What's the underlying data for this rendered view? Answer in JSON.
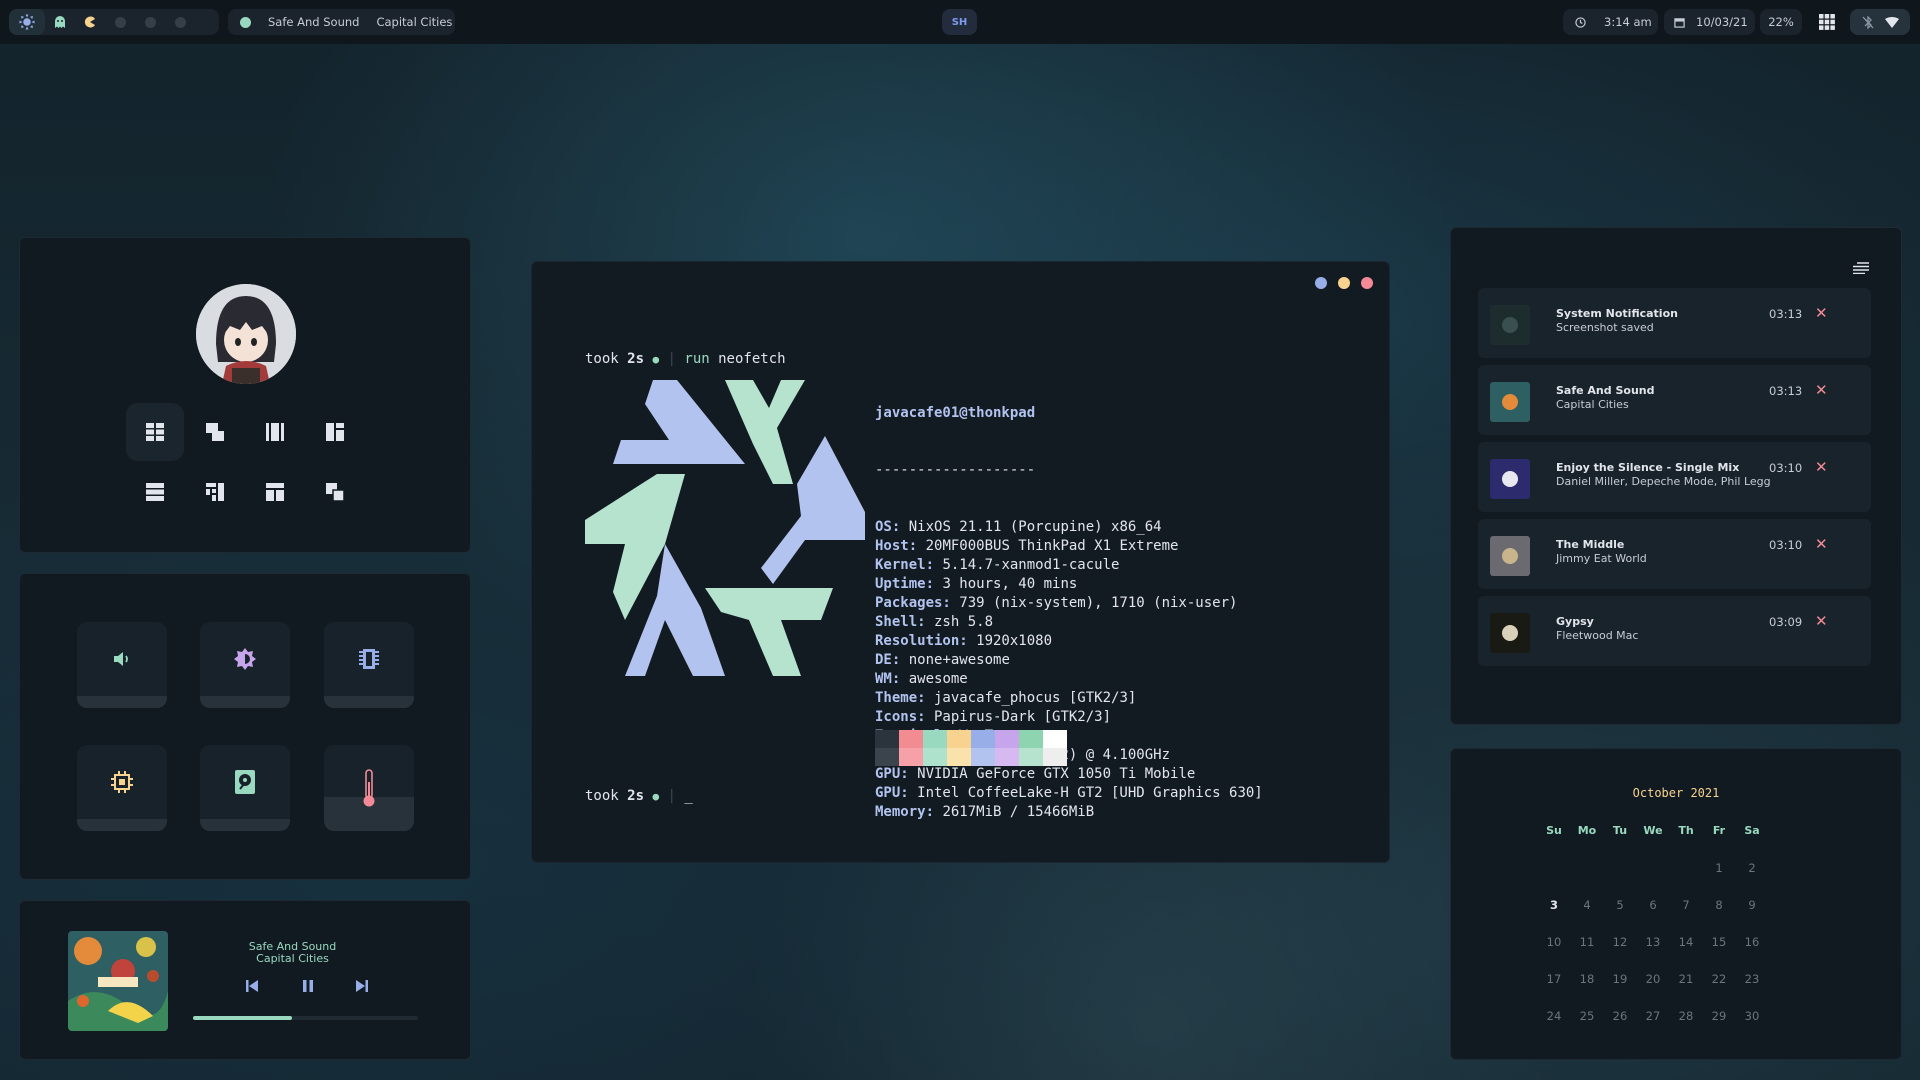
{
  "topbar": {
    "now_playing_title": "Safe And Sound",
    "now_playing_artist": "Capital Cities",
    "launcher_label": "SH",
    "time": "3:14 am",
    "date": "10/03/21",
    "battery": "22%"
  },
  "terminal": {
    "prompt1": {
      "took": "took",
      "duration": "2s",
      "cmd_prefix": "run",
      "command": "neofetch"
    },
    "user_host": "javacafe01@thonkpad",
    "separator": "-------------------",
    "info": [
      {
        "key": "OS:",
        "value": " NixOS 21.11 (Porcupine) x86_64"
      },
      {
        "key": "Host:",
        "value": " 20MF000BUS ThinkPad X1 Extreme"
      },
      {
        "key": "Kernel:",
        "value": " 5.14.7-xanmod1-cacule"
      },
      {
        "key": "Uptime:",
        "value": " 3 hours, 40 mins"
      },
      {
        "key": "Packages:",
        "value": " 739 (nix-system), 1710 (nix-user)"
      },
      {
        "key": "Shell:",
        "value": " zsh 5.8"
      },
      {
        "key": "Resolution:",
        "value": " 1920x1080"
      },
      {
        "key": "DE:",
        "value": " none+awesome"
      },
      {
        "key": "WM:",
        "value": " awesome"
      },
      {
        "key": "Theme:",
        "value": " javacafe_phocus [GTK2/3]"
      },
      {
        "key": "Icons:",
        "value": " Papirus-Dark [GTK2/3]"
      },
      {
        "key": "Terminal:",
        "value": " WezTerm"
      },
      {
        "key": "CPU:",
        "value": " Intel i7-8750H (12) @ 4.100GHz"
      },
      {
        "key": "GPU:",
        "value": " NVIDIA GeForce GTX 1050 Ti Mobile"
      },
      {
        "key": "GPU:",
        "value": " Intel CoffeeLake-H GT2 [UHD Graphics 630]"
      },
      {
        "key": "Memory:",
        "value": " 2617MiB / 15466MiB"
      }
    ],
    "prompt2": {
      "took": "took",
      "duration": "2s",
      "cursor": "_"
    },
    "palette_top": [
      "#2b333c",
      "#f38b93",
      "#98d9bf",
      "#f7d38f",
      "#98aee8",
      "#c7a5ed",
      "#8fd4b0",
      "#ffffff"
    ],
    "palette_bottom": [
      "#3b444d",
      "#f6a0a8",
      "#aee2cc",
      "#fae2ad",
      "#b2c3ef",
      "#d5b9f0",
      "#b5e3ce",
      "#eeeeee"
    ]
  },
  "music": {
    "title": "Safe And Sound",
    "artist": "Capital Cities",
    "progress": 0.44
  },
  "notifications": [
    {
      "title": "System Notification",
      "body": "Screenshot saved",
      "time": "03:13",
      "close": "✕"
    },
    {
      "title": "Safe And Sound",
      "body": "Capital Cities",
      "time": "03:13",
      "close": "✕"
    },
    {
      "title": "Enjoy the Silence - Single Mix",
      "body": "Daniel Miller, Depeche Mode, Phil Legg",
      "time": "03:10",
      "close": "✕"
    },
    {
      "title": "The Middle",
      "body": "Jimmy Eat World",
      "time": "03:10",
      "close": "✕"
    },
    {
      "title": "Gypsy",
      "body": "Fleetwood Mac",
      "time": "03:09",
      "close": "✕"
    }
  ],
  "calendar": {
    "title": "October 2021",
    "weekdays": [
      "Su",
      "Mo",
      "Tu",
      "We",
      "Th",
      "Fr",
      "Sa"
    ],
    "days": [
      "",
      "",
      "",
      "",
      "",
      "1",
      "2",
      "3",
      "4",
      "5",
      "6",
      "7",
      "8",
      "9",
      "10",
      "11",
      "12",
      "13",
      "14",
      "15",
      "16",
      "17",
      "18",
      "19",
      "20",
      "21",
      "22",
      "23",
      "24",
      "25",
      "26",
      "27",
      "28",
      "29",
      "30"
    ],
    "today": "3"
  },
  "controls": {
    "volume": 0.0,
    "brightness": 0.0,
    "ram": 0.0,
    "cpu": 0.0,
    "disk": 0.0,
    "temperature": 0.3
  },
  "colors": {
    "accent_green": "#98d9bf",
    "accent_blue": "#98aee8",
    "red": "#f48a97",
    "yellow": "#f7d38f",
    "purple": "#c7a5ed"
  }
}
